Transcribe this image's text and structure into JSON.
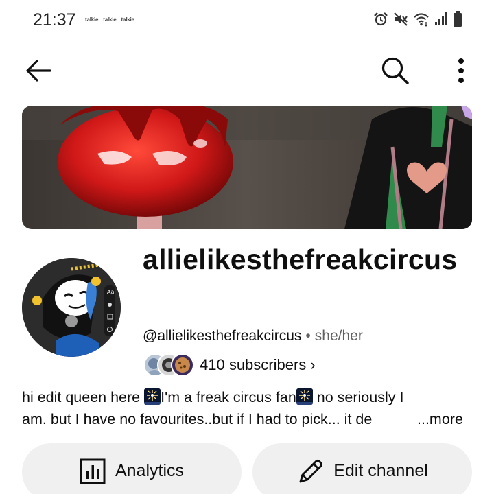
{
  "status_bar": {
    "time": "21:37",
    "notifications": [
      "talkie",
      "talkie",
      "talkie"
    ],
    "icons": [
      "alarm-icon",
      "mute-icon",
      "wifi-icon",
      "signal-icon",
      "battery-icon"
    ]
  },
  "app_bar": {
    "icons": [
      "back-arrow-icon",
      "search-icon",
      "more-vertical-icon"
    ]
  },
  "channel": {
    "name": "allielikesthefreakcircus",
    "handle": "@allielikesthefreakcircus",
    "separator": "•",
    "pronouns": "she/her",
    "subscribers": "410 subscribers",
    "subscribers_chevron": "›",
    "description_line1_a": "hi edit queen here ",
    "description_line1_b": "I'm a freak circus fan",
    "description_line1_c": " no seriously I",
    "description_line2_a": "am. but I have no favourites..but if I had to pick... it de",
    "more_label": "...more"
  },
  "actions": {
    "analytics_label": "Analytics",
    "edit_label": "Edit channel"
  },
  "colors": {
    "button_bg": "#f0f0f0",
    "secondary_text": "#606060",
    "banner_apple": "#d01818"
  }
}
